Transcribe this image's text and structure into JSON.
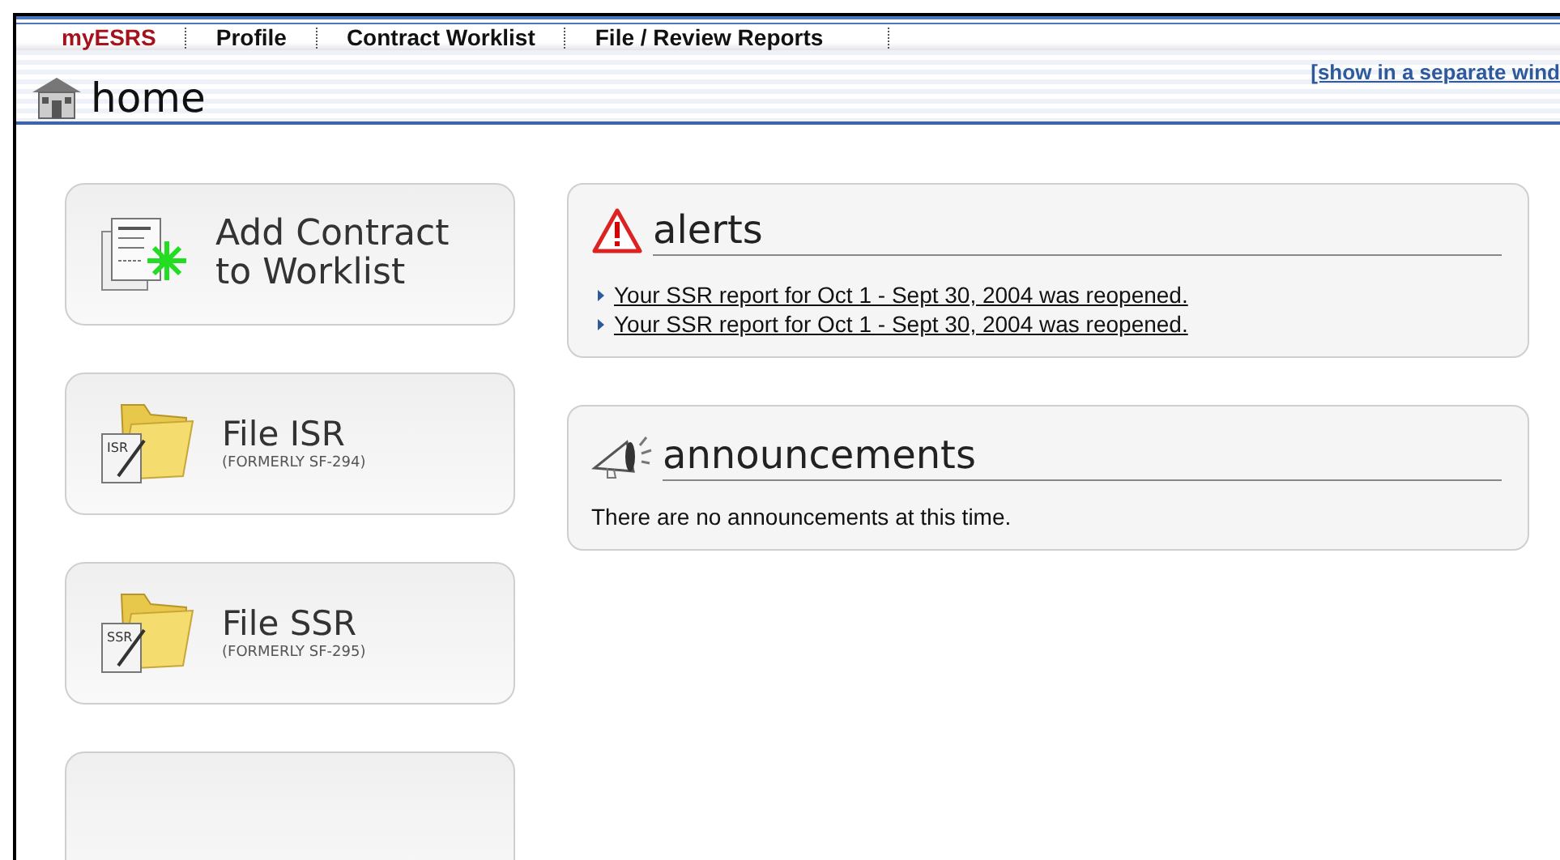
{
  "nav": {
    "items": [
      {
        "label": "myESRS",
        "selected": true
      },
      {
        "label": "Profile",
        "selected": false
      },
      {
        "label": "Contract Worklist",
        "selected": false
      },
      {
        "label": "File / Review Reports",
        "selected": false
      }
    ]
  },
  "header": {
    "title": "home",
    "link": "[show in a separate wind"
  },
  "tiles": [
    {
      "kind": "add",
      "title": "Add Contract to Worklist"
    },
    {
      "kind": "folder",
      "badge": "ISR",
      "title": "File ISR",
      "subtitle": "(FORMERLY SF-294)"
    },
    {
      "kind": "folder",
      "badge": "SSR",
      "title": "File SSR",
      "subtitle": "(FORMERLY SF-295)"
    }
  ],
  "alerts": {
    "title": "alerts",
    "items": [
      "Your SSR report for Oct 1 - Sept 30, 2004 was reopened.",
      "Your SSR report for Oct 1 - Sept 30, 2004 was reopened."
    ]
  },
  "announcements": {
    "title": "announcements",
    "text": "There are no announcements at this time."
  }
}
